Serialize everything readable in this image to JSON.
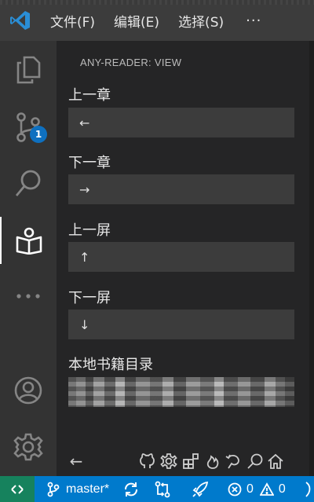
{
  "menu": {
    "items": [
      "文件(F)",
      "编辑(E)",
      "选择(S)"
    ],
    "more_label": "···"
  },
  "activity": {
    "scm_badge": "1"
  },
  "sidebar": {
    "title": "ANY-READER: VIEW",
    "fields": [
      {
        "label": "上一章",
        "value": "←"
      },
      {
        "label": "下一章",
        "value": "→"
      },
      {
        "label": "上一屏",
        "value": "↑"
      },
      {
        "label": "下一屏",
        "value": "↓"
      }
    ],
    "directory_label": "本地书籍目录",
    "toolbar_back": "←"
  },
  "statusbar": {
    "branch": "master*",
    "errors": "0",
    "warnings": "0"
  },
  "colors": {
    "accent": "#007acc",
    "remote": "#16825d",
    "badge": "#0e70c0"
  }
}
